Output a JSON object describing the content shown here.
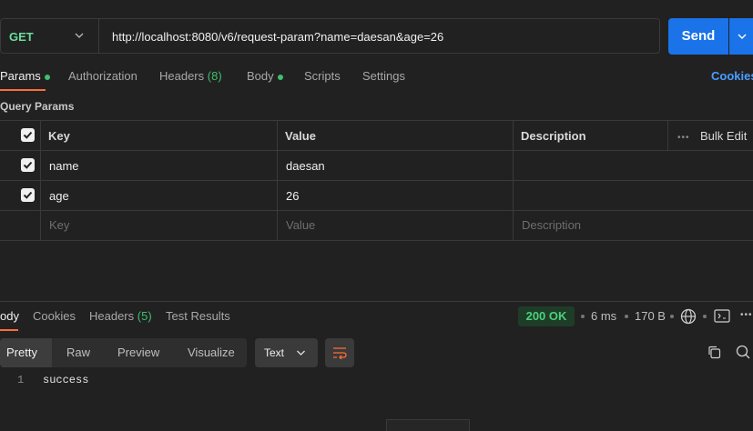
{
  "request": {
    "method": "GET",
    "url": "http://localhost:8080/v6/request-param?name=daesan&age=26",
    "send_label": "Send"
  },
  "tabs": [
    {
      "label": "Params",
      "dot": true,
      "active": true
    },
    {
      "label": "Authorization"
    },
    {
      "label": "Headers",
      "count": "(8)"
    },
    {
      "label": "Body",
      "dot": true
    },
    {
      "label": "Scripts"
    },
    {
      "label": "Settings"
    }
  ],
  "cookies_link": "Cookies",
  "query_params": {
    "title": "Query Params",
    "headers": {
      "key": "Key",
      "value": "Value",
      "description": "Description",
      "bulk_edit": "Bulk Edit"
    },
    "rows": [
      {
        "checked": true,
        "key": "name",
        "value": "daesan",
        "description": ""
      },
      {
        "checked": true,
        "key": "age",
        "value": "26",
        "description": ""
      }
    ],
    "placeholder": {
      "key": "Key",
      "value": "Value",
      "description": "Description"
    }
  },
  "response": {
    "tabs": [
      {
        "label": "ody",
        "active": true
      },
      {
        "label": "Cookies"
      },
      {
        "label": "Headers",
        "count": "(5)"
      },
      {
        "label": "Test Results"
      }
    ],
    "status": "200 OK",
    "time": "6 ms",
    "size": "170 B",
    "view_modes": [
      "Pretty",
      "Raw",
      "Preview",
      "Visualize"
    ],
    "format": "Text",
    "body_lines": [
      {
        "n": "1",
        "text": "success"
      }
    ]
  },
  "colors": {
    "accent_orange": "#ff6c37",
    "send_blue": "#1a73e8",
    "status_green": "#4cd07d"
  }
}
